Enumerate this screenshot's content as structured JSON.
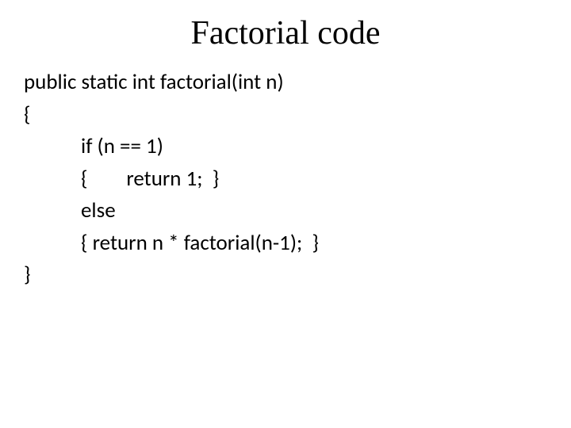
{
  "slide": {
    "title": "Factorial code",
    "code": {
      "line1": "public static int factorial(int n)",
      "line2": "{",
      "line3": "if (n == 1)",
      "line4": "{        return 1;  }",
      "line5": "else",
      "line6": "{ return n * factorial(n-1);  }",
      "line7": "}"
    }
  }
}
